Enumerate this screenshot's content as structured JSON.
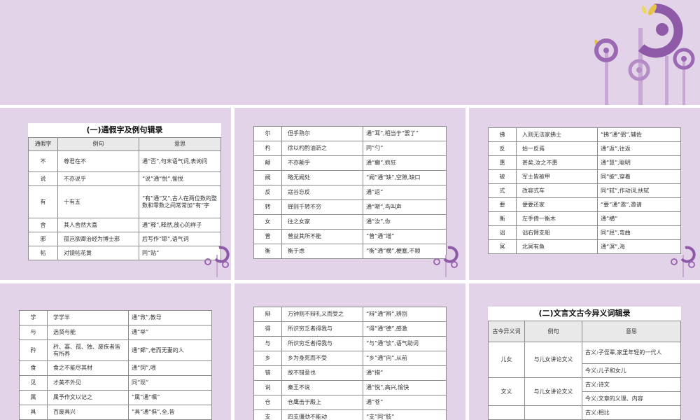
{
  "colors": {
    "background": "#e3d3e8",
    "accent": "#8e5aa8",
    "light_accent": "#b58cc6",
    "leaf": "#e6c44a"
  },
  "sheet1": {
    "title": "(一)通假字及例句辑录",
    "headers": [
      "通假字",
      "例句",
      "意思"
    ],
    "rows": [
      [
        "不",
        "尊君在不",
        "通“否”,句末语气词,表询问"
      ],
      [
        "说",
        "不亦说乎",
        "“说”通“悦”,愉悦"
      ],
      [
        "有",
        "十有五",
        "“有”通“又”,古人在两位数的整数和零数之间常常加“有”字"
      ],
      [
        "舍",
        "其人舍然大喜",
        "通“释”,释然,放心的样子"
      ],
      [
        "邪",
        "孤岂欲卿治经为博士邪",
        "后写作“耶”,语气词"
      ],
      [
        "帖",
        "对镜帖花黄",
        "同“贴”"
      ]
    ]
  },
  "sheet2": {
    "rows": [
      [
        "尔",
        "但手熟尔",
        "通“耳”,相当于“罢了”"
      ],
      [
        "杓",
        "徐以杓酌油沥之",
        "同“勺”"
      ],
      [
        "颠",
        "不亦颠乎",
        "通“癫”,疯狂"
      ],
      [
        "阙",
        "略无阙处",
        "“阙”通“缺”,空隙,缺口"
      ],
      [
        "反",
        "寇谷忘反",
        "通“返”"
      ],
      [
        "转",
        "蝉则千转不穷",
        "通“啭”,鸟叫声"
      ],
      [
        "女",
        "往之女家",
        "通“汝”,你"
      ],
      [
        "曾",
        "曾益其所不能",
        "“曾”通“增”"
      ],
      [
        "衡",
        "衡于虑",
        "“衡”通“横”,梗塞,不顺"
      ]
    ]
  },
  "sheet3": {
    "rows": [
      [
        "拂",
        "入则无法家拂士",
        "“拂”通“弼”,辅佐"
      ],
      [
        "反",
        "始一反焉",
        "通“返”,往返"
      ],
      [
        "惠",
        "甚矣,汝之不惠",
        "通“慧”,聪明"
      ],
      [
        "被",
        "军士皆被甲",
        "同“披”,穿着"
      ],
      [
        "式",
        "改容式车",
        "同“轼”,作动词,扶轼"
      ],
      [
        "要",
        "便要还家",
        "“要”通“邀”,邀请"
      ],
      [
        "衡",
        "左手倚一衡木",
        "通“横”"
      ],
      [
        "诎",
        "诎右臂支船",
        "同“屈”,弯曲"
      ],
      [
        "冥",
        "北冥有鱼",
        "通“溟”,海"
      ]
    ]
  },
  "sheet4": {
    "rows": [
      [
        "学",
        "学学半",
        "通“敩”,教导"
      ],
      [
        "与",
        "选贤与能",
        "通“举”"
      ],
      [
        "矜",
        "矜、寡、孤、独、废疾者皆有所养",
        "通“鳏”,老而无妻的人"
      ],
      [
        "食",
        "食之不能尽其材",
        "通“饲”,喂"
      ],
      [
        "见",
        "才美不外见",
        "同“现”"
      ],
      [
        "属",
        "属予作文以记之",
        "“属”通“嘱”"
      ],
      [
        "具",
        "百废具兴",
        "“具”通“俱”,全,皆"
      ]
    ]
  },
  "sheet5": {
    "rows": [
      [
        "辩",
        "万钟则不辩礼义而受之",
        "“辩”通“辨”,辨别"
      ],
      [
        "得",
        "所识穷乏者得我与",
        "“得”通“德”,感激"
      ],
      [
        "与",
        "所识穷乏者得我与",
        "“与”通“欤”,语气助词"
      ],
      [
        "乡",
        "乡为身死而不受",
        "“乡”通“向”,从前"
      ],
      [
        "错",
        "故不错意也",
        "通“措”"
      ],
      [
        "说",
        "秦王不说",
        "通“悦”,高兴,愉快"
      ],
      [
        "仓",
        "仓鹰击于殿上",
        "通“苍”"
      ],
      [
        "支",
        "四支僵劲不能动",
        "“支”同“肢”"
      ]
    ]
  },
  "sheet6": {
    "title": "(二)文言文古今异义词辑录",
    "headers": [
      "古今异义词",
      "例句",
      "意思"
    ],
    "rows": [
      {
        "word": "儿女",
        "example": "与儿女讲论文义",
        "meanings": [
          "古义:子侄辈,家里年轻的一代人",
          "今义:儿子和女儿"
        ]
      },
      {
        "word": "文义",
        "example": "与儿女讲论文义",
        "meanings": [
          "古义:诗文",
          "今义:文章的义理、内容"
        ]
      },
      {
        "word": "",
        "example": "",
        "meanings": [
          "古义:相比"
        ]
      }
    ]
  }
}
